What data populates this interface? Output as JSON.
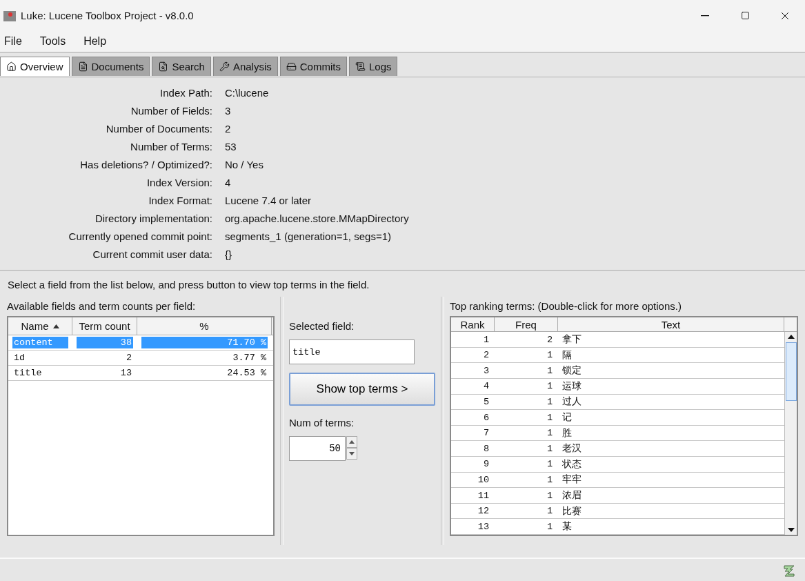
{
  "window": {
    "title": "Luke: Lucene Toolbox Project - v8.0.0"
  },
  "menu": [
    "File",
    "Tools",
    "Help"
  ],
  "tabs": [
    {
      "label": "Overview",
      "selected": true
    },
    {
      "label": "Documents",
      "selected": false
    },
    {
      "label": "Search",
      "selected": false
    },
    {
      "label": "Analysis",
      "selected": false
    },
    {
      "label": "Commits",
      "selected": false
    },
    {
      "label": "Logs",
      "selected": false
    }
  ],
  "overview": [
    {
      "label": "Index Path:",
      "value": "C:\\lucene"
    },
    {
      "label": "Number of Fields:",
      "value": "3"
    },
    {
      "label": "Number of Documents:",
      "value": "2"
    },
    {
      "label": "Number of Terms:",
      "value": "53"
    },
    {
      "label": "Has deletions? / Optimized?:",
      "value": "No / Yes"
    },
    {
      "label": "Index Version:",
      "value": "4"
    },
    {
      "label": "Index Format:",
      "value": "Lucene 7.4 or later"
    },
    {
      "label": "Directory implementation:",
      "value": "org.apache.lucene.store.MMapDirectory"
    },
    {
      "label": "Currently opened commit point:",
      "value": "segments_1 (generation=1, segs=1)"
    },
    {
      "label": "Current commit user data:",
      "value": "{}"
    }
  ],
  "instruction": "Select a field from the list below, and press button to view top terms in the field.",
  "fields_panel": {
    "title": "Available fields and term counts per field:",
    "columns": [
      {
        "label": "Name",
        "sorted": true
      },
      {
        "label": "Term count",
        "sorted": false
      },
      {
        "label": "%",
        "sorted": false
      }
    ],
    "rows": [
      {
        "name": "content",
        "term_count": "38",
        "percent": "71.70 %",
        "selected": true
      },
      {
        "name": "id",
        "term_count": "2",
        "percent": "3.77 %",
        "selected": false
      },
      {
        "name": "title",
        "term_count": "13",
        "percent": "24.53 %",
        "selected": false
      }
    ]
  },
  "selection_panel": {
    "field_label": "Selected field:",
    "field_value": "title",
    "button": "Show top terms >",
    "num_label": "Num of terms:",
    "num_value": "50"
  },
  "terms_panel": {
    "title": "Top ranking terms: (Double-click for more options.)",
    "columns": [
      "Rank",
      "Freq",
      "Text"
    ],
    "rows": [
      {
        "rank": "1",
        "freq": "2",
        "text": "拿下"
      },
      {
        "rank": "2",
        "freq": "1",
        "text": "隔"
      },
      {
        "rank": "3",
        "freq": "1",
        "text": "锁定"
      },
      {
        "rank": "4",
        "freq": "1",
        "text": "运球"
      },
      {
        "rank": "5",
        "freq": "1",
        "text": "过人"
      },
      {
        "rank": "6",
        "freq": "1",
        "text": "记"
      },
      {
        "rank": "7",
        "freq": "1",
        "text": "胜"
      },
      {
        "rank": "8",
        "freq": "1",
        "text": "老汉"
      },
      {
        "rank": "9",
        "freq": "1",
        "text": "状态"
      },
      {
        "rank": "10",
        "freq": "1",
        "text": "牢牢"
      },
      {
        "rank": "11",
        "freq": "1",
        "text": "浓眉"
      },
      {
        "rank": "12",
        "freq": "1",
        "text": "比赛"
      },
      {
        "rank": "13",
        "freq": "1",
        "text": "某"
      }
    ]
  }
}
